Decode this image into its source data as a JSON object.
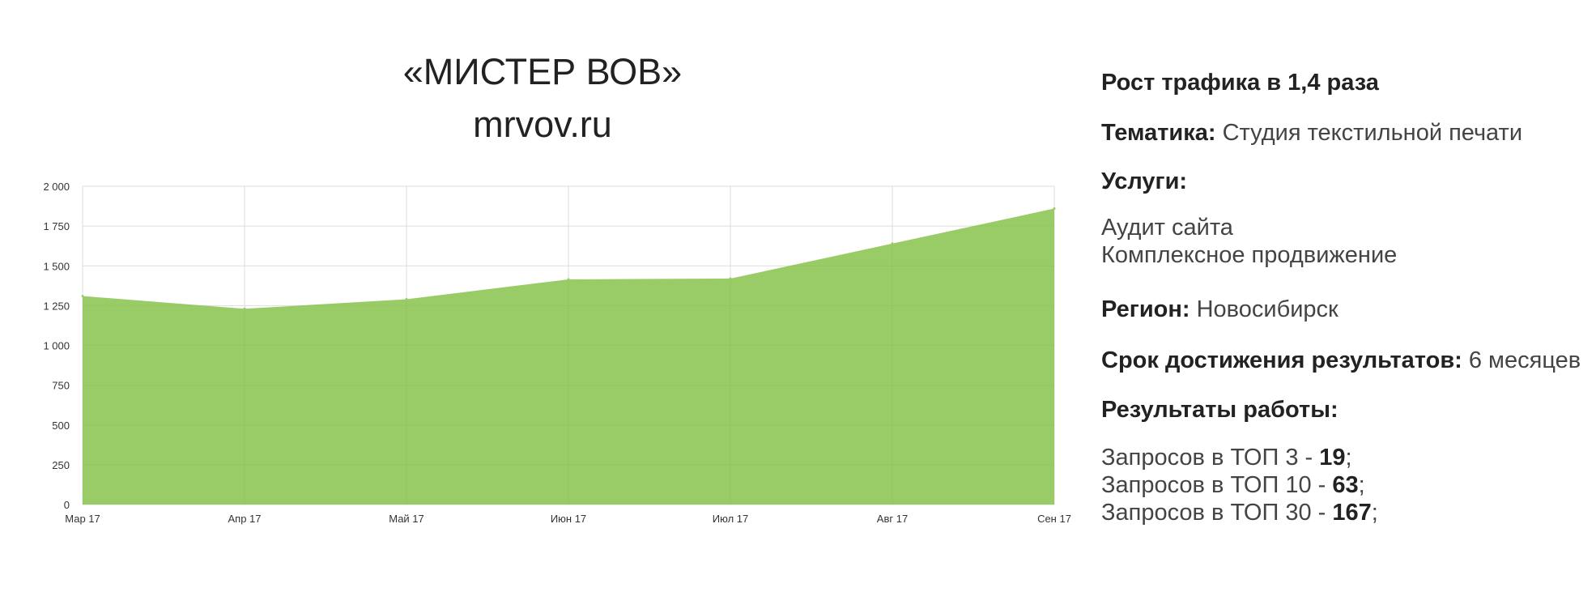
{
  "header": {
    "project_name": "«МИСТЕР ВОВ»",
    "site_url": "mrvov.ru"
  },
  "info": {
    "traffic_growth": "Рост трафика в 1,4 раза",
    "theme_label": "Тематика:",
    "theme_value": " Студия текстильной печати",
    "services_label": "Услуги:",
    "services": [
      "Аудит сайта",
      "Комплексное продвижение"
    ],
    "region_label": "Регион:",
    "region_value": " Новосибирск",
    "term_label": "Срок достижения результатов:",
    "term_value": " 6 месяцев",
    "results_label": "Результаты работы:",
    "results": [
      {
        "prefix": "Запросов в ТОП 3 - ",
        "value": "19",
        "suffix": ";"
      },
      {
        "prefix": "Запросов в ТОП 10 - ",
        "value": "63",
        "suffix": ";"
      },
      {
        "prefix": "Запросов в ТОП 30 - ",
        "value": "167",
        "suffix": ";"
      }
    ]
  },
  "chart_data": {
    "type": "area",
    "title": "",
    "xlabel": "",
    "ylabel": "",
    "categories": [
      "Мар 17",
      "Апр 17",
      "Май 17",
      "Июн 17",
      "Июл 17",
      "Авг 17",
      "Сен 17"
    ],
    "series": [
      {
        "values": [
          1310,
          1230,
          1290,
          1415,
          1420,
          1640,
          1860
        ]
      }
    ],
    "ylim": [
      0,
      2000
    ],
    "yticks": [
      0,
      250,
      500,
      750,
      1000,
      1250,
      1500,
      1750,
      2000
    ],
    "ytick_labels": [
      "0",
      "250",
      "500",
      "750",
      "1 000",
      "1 250",
      "1 500",
      "1 750",
      "2 000"
    ],
    "grid": true,
    "legend": "none",
    "colors": {
      "fill": "#99cc66",
      "grid": "#e6e6e6",
      "axis_text": "#333333"
    }
  }
}
